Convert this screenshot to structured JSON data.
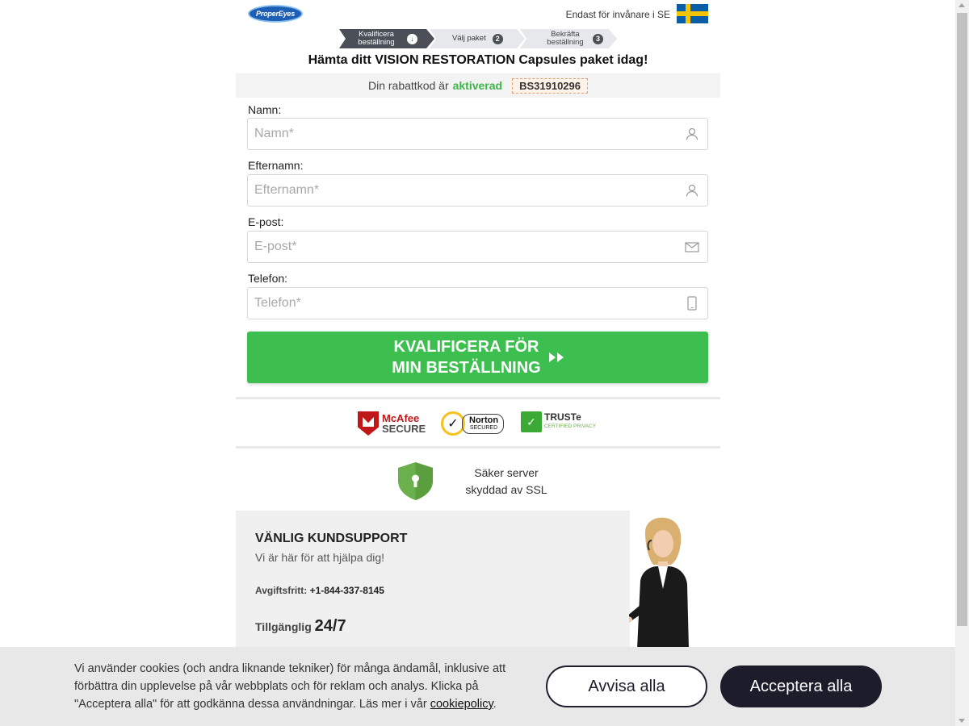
{
  "header": {
    "logo_text": "ProperEyes",
    "residents_text": "Endast för invånare i SE",
    "flag": "sweden-flag"
  },
  "steps": [
    {
      "label": "Kvalificera beställning",
      "badge": "↓"
    },
    {
      "label": "Välj paket",
      "badge": "2"
    },
    {
      "label": "Bekräfta beställning",
      "badge": "3"
    }
  ],
  "headline": "Hämta ditt VISION RESTORATION Capsules paket idag!",
  "discount": {
    "prefix": "Din rabattkod är",
    "status": "aktiverad",
    "code": "BS31910296",
    "status_color": "#3cb54a"
  },
  "form": {
    "fields": [
      {
        "label": "Namn:",
        "placeholder": "Namn*",
        "value": "",
        "icon": "user-icon"
      },
      {
        "label": "Efternamn:",
        "placeholder": "Efternamn*",
        "value": "",
        "icon": "user-icon"
      },
      {
        "label": "E-post:",
        "placeholder": "E-post*",
        "value": "",
        "icon": "envelope-icon"
      },
      {
        "label": "Telefon:",
        "placeholder": "Telefon*",
        "value": "",
        "icon": "phone-icon"
      }
    ],
    "submit_line1": "KVALIFICERA FÖR",
    "submit_line2": "MIN BESTÄLLNING",
    "submit_color": "#3cbf4f"
  },
  "trust": {
    "mcafee_1": "McAfee",
    "mcafee_2": "SECURE",
    "norton_1": "Norton",
    "norton_2": "SECURED",
    "truste_1": "TRUSTe",
    "truste_2": "CERTIFIED PRIVACY"
  },
  "ssl": {
    "line1": "Säker server",
    "line2": "skyddad av SSL"
  },
  "support": {
    "title": "VÄNLIG KUNDSUPPORT",
    "subtitle": "Vi är här för att hjälpa dig!",
    "phone_label": "Avgiftsfritt:",
    "phone": "+1-844-337-8145",
    "avail_label": "Tillgänglig",
    "avail_value": "24/7"
  },
  "cookie": {
    "text": "Vi använder cookies (och andra liknande tekniker) för många ändamål, inklusive att förbättra din upplevelse på vår webbplats och för reklam och analys. Klicka på \"Acceptera alla\" för att godkänna dessa användningar. Läs mer i vår",
    "link": "cookiepolicy",
    "end": ".",
    "reject": "Avvisa alla",
    "accept": "Acceptera alla"
  }
}
